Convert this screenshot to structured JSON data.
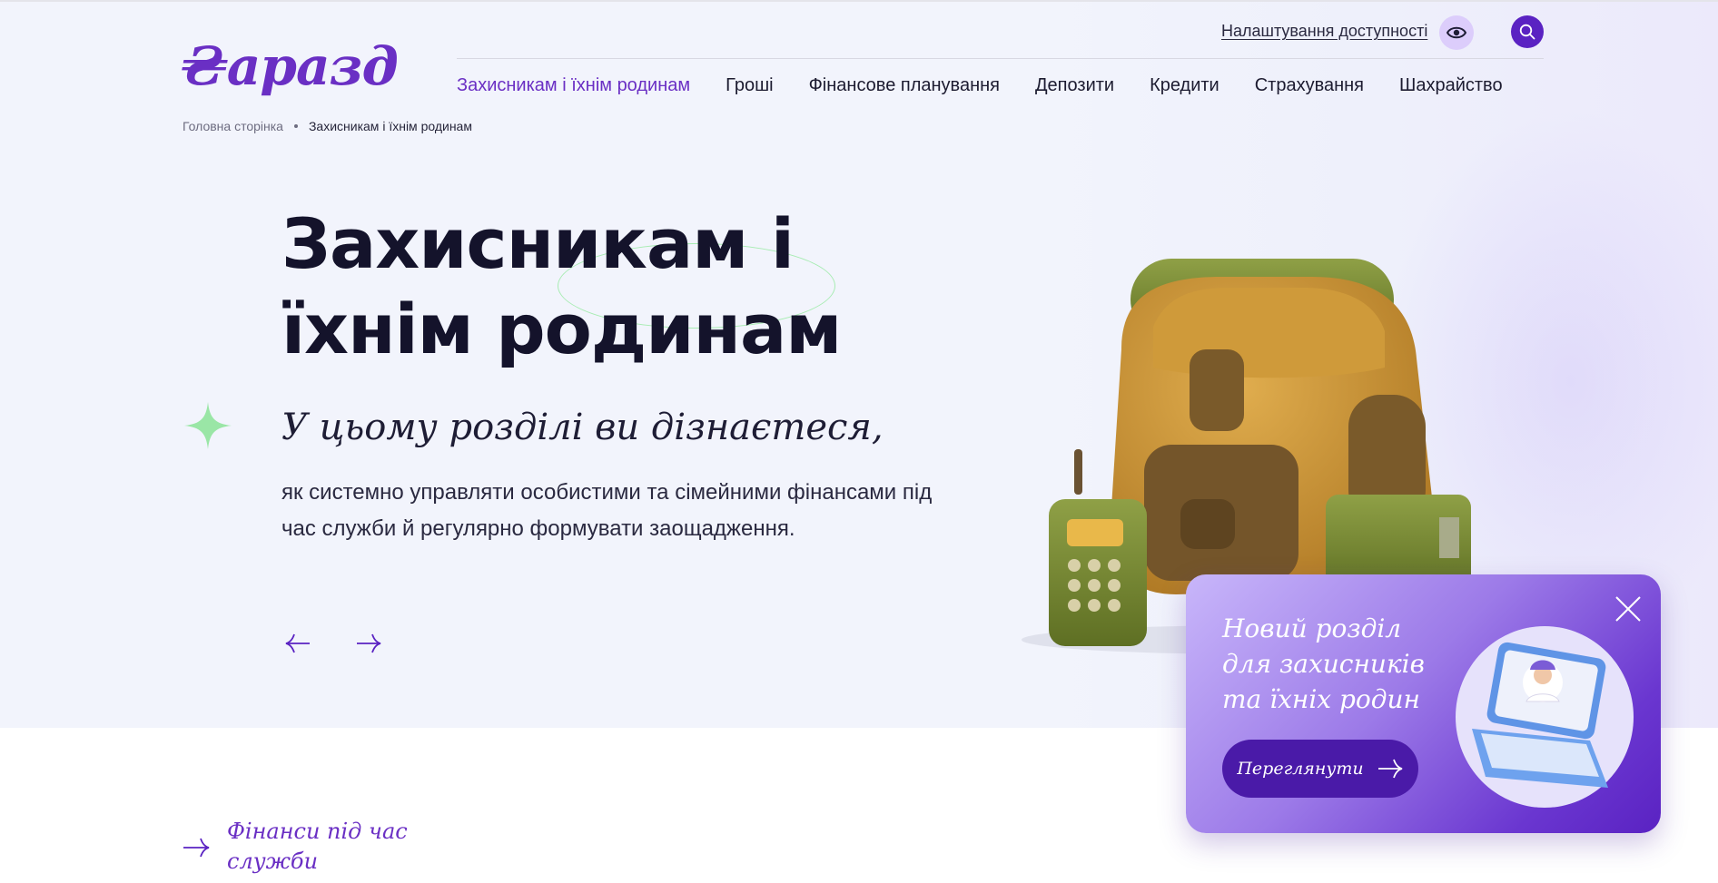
{
  "header": {
    "logo_text": "₴аразд",
    "accessibility_label": "Налаштування доступності",
    "icons": {
      "eye": "eye-icon",
      "search": "search-icon"
    }
  },
  "nav": {
    "items": [
      {
        "label": "Захисникам і їхнім родинам",
        "active": true
      },
      {
        "label": "Гроші",
        "active": false
      },
      {
        "label": "Фінансове планування",
        "active": false
      },
      {
        "label": "Депозити",
        "active": false
      },
      {
        "label": "Кредити",
        "active": false
      },
      {
        "label": "Страхування",
        "active": false
      },
      {
        "label": "Шахрайство",
        "active": false
      }
    ]
  },
  "breadcrumb": {
    "home": "Головна сторінка",
    "current": "Захисникам і їхнім родинам"
  },
  "hero": {
    "title": "Захисникам і їхнім родинам",
    "subtitle": "У цьому розділі ви дізнаєтеся,",
    "description": "як системно управляти особистими та сімейними фінансами під час служби й регулярно формувати заощадження.",
    "icons": {
      "prev": "arrow-left-icon",
      "next": "arrow-right-icon",
      "sparkle": "sparkle-icon"
    }
  },
  "section": {
    "link_label": "Фінанси під час служби"
  },
  "promo": {
    "title": "Новий розділ для захисників та їхніх родин",
    "button_label": "Переглянути",
    "icons": {
      "close": "close-icon",
      "arrow": "arrow-right-icon"
    }
  },
  "colors": {
    "accent": "#6a2fc4",
    "accent_dark": "#5a22c2",
    "hero_bg": "#f2f4fc",
    "sparkle": "#9ae6a6",
    "text": "#14132b"
  }
}
